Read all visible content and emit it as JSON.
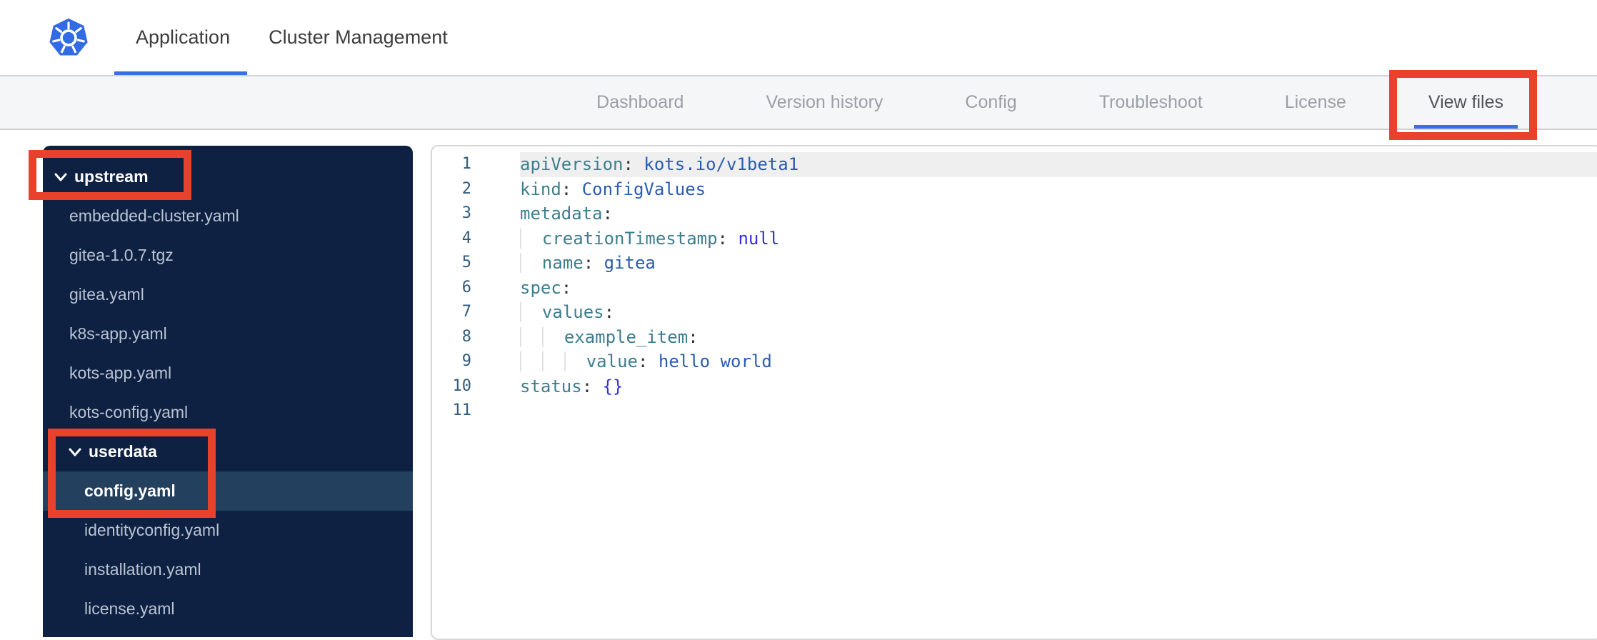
{
  "topbar": {
    "tabs": [
      {
        "label": "Application",
        "active": true
      },
      {
        "label": "Cluster Management",
        "active": false
      }
    ]
  },
  "subnav": {
    "tabs": [
      {
        "label": "Dashboard",
        "active": false
      },
      {
        "label": "Version history",
        "active": false
      },
      {
        "label": "Config",
        "active": false
      },
      {
        "label": "Troubleshoot",
        "active": false
      },
      {
        "label": "License",
        "active": false
      },
      {
        "label": "View files",
        "active": true
      }
    ]
  },
  "file_tree": {
    "items": [
      {
        "label": "upstream",
        "type": "folder",
        "level": 0,
        "expanded": true
      },
      {
        "label": "embedded-cluster.yaml",
        "type": "file",
        "level": 1
      },
      {
        "label": "gitea-1.0.7.tgz",
        "type": "file",
        "level": 1
      },
      {
        "label": "gitea.yaml",
        "type": "file",
        "level": 1
      },
      {
        "label": "k8s-app.yaml",
        "type": "file",
        "level": 1
      },
      {
        "label": "kots-app.yaml",
        "type": "file",
        "level": 1
      },
      {
        "label": "kots-config.yaml",
        "type": "file",
        "level": 1
      },
      {
        "label": "userdata",
        "type": "folder",
        "level": 1,
        "expanded": true
      },
      {
        "label": "config.yaml",
        "type": "file",
        "level": 2,
        "selected": true
      },
      {
        "label": "identityconfig.yaml",
        "type": "file",
        "level": 2
      },
      {
        "label": "installation.yaml",
        "type": "file",
        "level": 2
      },
      {
        "label": "license.yaml",
        "type": "file",
        "level": 2
      }
    ]
  },
  "editor": {
    "language": "yaml",
    "lines": [
      {
        "num": 1,
        "active": true,
        "indent": 0,
        "tokens": [
          [
            "k",
            "apiVersion"
          ],
          [
            "o",
            ": "
          ],
          [
            "v",
            "kots.io/v1beta1"
          ]
        ]
      },
      {
        "num": 2,
        "indent": 0,
        "tokens": [
          [
            "k",
            "kind"
          ],
          [
            "o",
            ": "
          ],
          [
            "v",
            "ConfigValues"
          ]
        ]
      },
      {
        "num": 3,
        "indent": 0,
        "tokens": [
          [
            "k",
            "metadata"
          ],
          [
            "o",
            ":"
          ]
        ]
      },
      {
        "num": 4,
        "indent": 2,
        "tokens": [
          [
            "k",
            "creationTimestamp"
          ],
          [
            "o",
            ": "
          ],
          [
            "c",
            "null"
          ]
        ]
      },
      {
        "num": 5,
        "indent": 2,
        "tokens": [
          [
            "k",
            "name"
          ],
          [
            "o",
            ": "
          ],
          [
            "v",
            "gitea"
          ]
        ]
      },
      {
        "num": 6,
        "indent": 0,
        "tokens": [
          [
            "k",
            "spec"
          ],
          [
            "o",
            ":"
          ]
        ]
      },
      {
        "num": 7,
        "indent": 2,
        "tokens": [
          [
            "k",
            "values"
          ],
          [
            "o",
            ":"
          ]
        ]
      },
      {
        "num": 8,
        "indent": 4,
        "tokens": [
          [
            "k",
            "example_item"
          ],
          [
            "o",
            ":"
          ]
        ]
      },
      {
        "num": 9,
        "indent": 6,
        "tokens": [
          [
            "k",
            "value"
          ],
          [
            "o",
            ": "
          ],
          [
            "v",
            "hello world"
          ]
        ]
      },
      {
        "num": 10,
        "indent": 0,
        "tokens": [
          [
            "k",
            "status"
          ],
          [
            "o",
            ": "
          ],
          [
            "c",
            "{}"
          ]
        ]
      },
      {
        "num": 11,
        "indent": 0,
        "tokens": []
      }
    ]
  },
  "annotations": [
    "upstream-folder",
    "userdata-config-yaml",
    "view-files-tab"
  ],
  "icons": [
    "kubernetes-logo",
    "chevron-down-icon"
  ],
  "colors": {
    "accent": "#3b6de4",
    "annotation_red": "#e8422d",
    "kubernetes_blue": "#326ce5",
    "topnav_text": "#3d3d3d",
    "subnav_text": "#9aa0a6",
    "subnav_active_text": "#4f5559",
    "sidebar_bg": "#0e2143",
    "sidebar_selected_bg": "#23405f",
    "sidebar_file_text": "#b9c3d2",
    "gutter_text": "#315b7d",
    "key_color": "#3d7e8e",
    "value_color": "#2b5cb0",
    "const_color": "#3430d4",
    "active_line_bg": "#efefef"
  }
}
